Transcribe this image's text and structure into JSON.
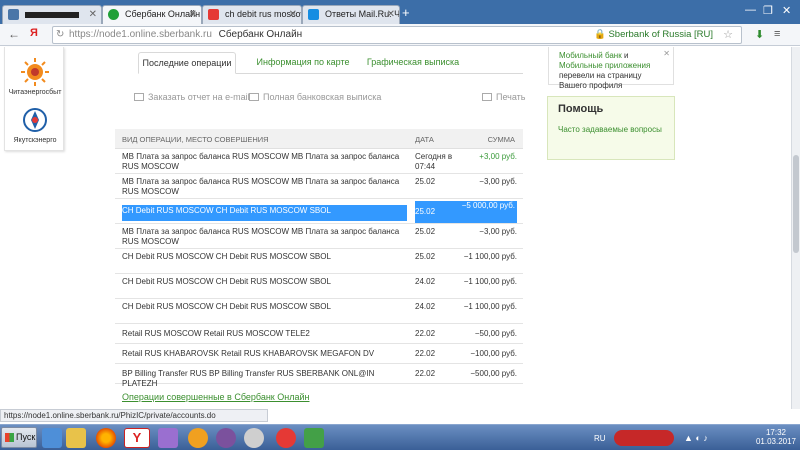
{
  "browser": {
    "tabs": [
      {
        "label": "",
        "active": false
      },
      {
        "label": "Сбербанк Онлайн",
        "active": true
      },
      {
        "label": "ch debit rus moscow ch c",
        "active": false
      },
      {
        "label": "Ответы Mail.Ru: Что уз",
        "active": false
      }
    ],
    "new_tab": "+",
    "address": {
      "url": "https://node1.online.sberbank.ru",
      "title": "Сбербанк Онлайн",
      "security": "Sberbank of Russia [RU]"
    },
    "status_url": "https://node1.online.sberbank.ru/PhizIC/private/accounts.do"
  },
  "partners": [
    {
      "name": "Читаэнергосбыт",
      "color": "#f28b1e"
    },
    {
      "name": "Якутскэнерго",
      "color": "#1f5fa8"
    }
  ],
  "content_tabs": [
    {
      "label": "Последние операции",
      "active": true
    },
    {
      "label": "Информация по карте",
      "active": false
    },
    {
      "label": "Графическая выписка",
      "active": false
    }
  ],
  "actions": {
    "email": "Заказать отчет на e-mail",
    "full_statement": "Полная банковская выписка",
    "print": "Печать"
  },
  "table": {
    "headers": {
      "op": "ВИД ОПЕРАЦИИ, МЕСТО СОВЕРШЕНИЯ",
      "date": "ДАТА",
      "amount": "СУММА"
    },
    "rows": [
      {
        "desc": "MB Плата за запрос баланса RUS MOSCOW MB Плата за запрос баланса RUS MOSCOW",
        "date": "Сегодня в 07:44",
        "amount": "+3,00 руб.",
        "positive": true,
        "selected": false
      },
      {
        "desc": "MB Плата за запрос баланса RUS MOSCOW MB Плата за запрос баланса RUS MOSCOW",
        "date": "25.02",
        "amount": "−3,00 руб.",
        "positive": false,
        "selected": false
      },
      {
        "desc": "CH Debit RUS MOSCOW CH Debit RUS MOSCOW SBOL",
        "date": "25.02",
        "amount": "−5 000,00 руб.",
        "positive": false,
        "selected": true
      },
      {
        "desc": "MB Плата за запрос баланса RUS MOSCOW MB Плата за запрос баланса RUS MOSCOW",
        "date": "25.02",
        "amount": "−3,00 руб.",
        "positive": false,
        "selected": false
      },
      {
        "desc": "CH Debit RUS MOSCOW CH Debit RUS MOSCOW SBOL",
        "date": "25.02",
        "amount": "−1 100,00 руб.",
        "positive": false,
        "selected": false
      },
      {
        "desc": "CH Debit RUS MOSCOW CH Debit RUS MOSCOW SBOL",
        "date": "24.02",
        "amount": "−1 100,00 руб.",
        "positive": false,
        "selected": false
      },
      {
        "desc": "CH Debit RUS MOSCOW CH Debit RUS MOSCOW SBOL",
        "date": "24.02",
        "amount": "−1 100,00 руб.",
        "positive": false,
        "selected": false
      },
      {
        "desc": "Retail RUS MOSCOW Retail RUS MOSCOW TELE2",
        "date": "22.02",
        "amount": "−50,00 руб.",
        "positive": false,
        "selected": false
      },
      {
        "desc": "Retail RUS KHABAROVSK Retail RUS KHABAROVSK MEGAFON DV",
        "date": "22.02",
        "amount": "−100,00 руб.",
        "positive": false,
        "selected": false
      },
      {
        "desc": "BP Billing Transfer RUS BP Billing Transfer RUS SBERBANK ONL@IN PLATEZH",
        "date": "22.02",
        "amount": "−500,00 руб.",
        "positive": false,
        "selected": false
      }
    ]
  },
  "footer_link": "Операции совершенные в Сбербанк Онлайн",
  "sidebar": {
    "notice": {
      "link1": "Мобильный банк",
      "and": "и",
      "link2": "Мобильные приложения",
      "text": "перевели на страницу Вашего профиля"
    },
    "help": {
      "title": "Помощь",
      "faq": "Часто задаваемые вопросы"
    }
  },
  "taskbar": {
    "start": "Пуск",
    "lang": "RU",
    "time": "17:32",
    "date": "01.03.2017"
  }
}
